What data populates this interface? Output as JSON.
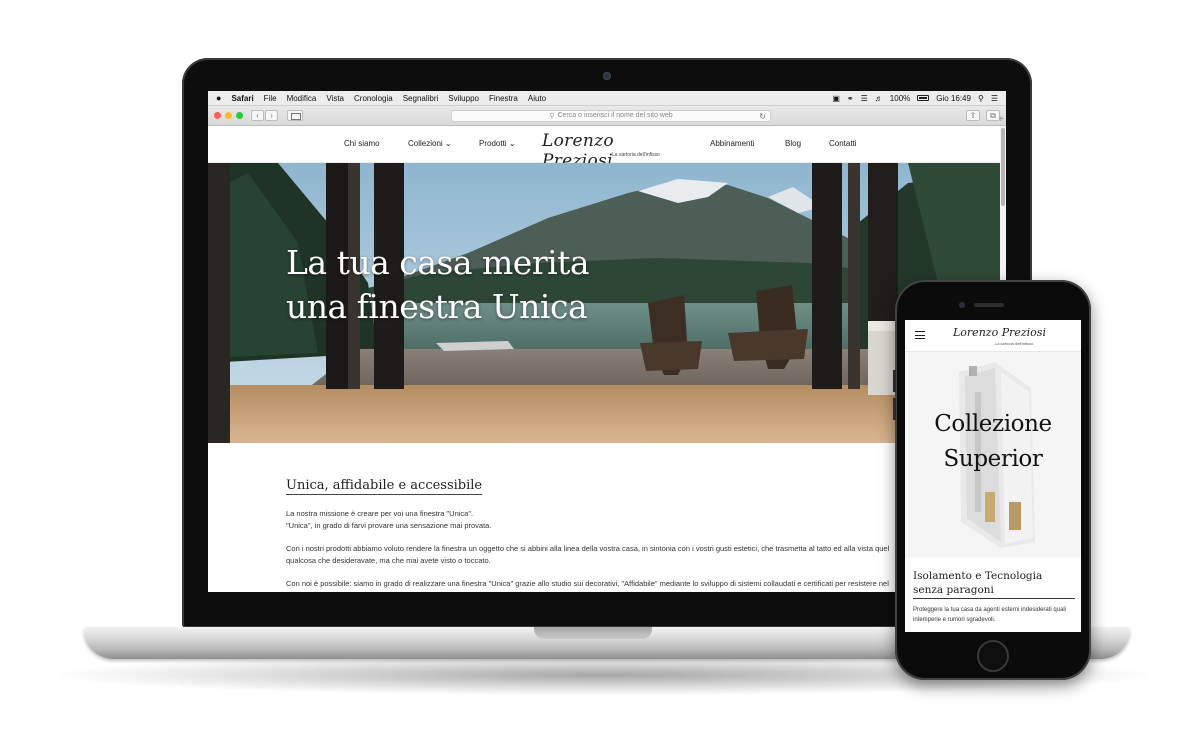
{
  "mac_menubar": {
    "apple": "",
    "items": [
      "Safari",
      "File",
      "Modifica",
      "Vista",
      "Cronologia",
      "Segnalibri",
      "Sviluppo",
      "Finestra",
      "Aiuto"
    ],
    "battery_text": "100%",
    "clock": "Gio 16:49"
  },
  "safari": {
    "address_placeholder": "Cerca o inserisci il nome del sito web"
  },
  "site": {
    "nav": {
      "chi_siamo": "Chi siamo",
      "collezioni": "Collezioni",
      "prodotti": "Prodotti",
      "abbinamenti": "Abbinamenti",
      "blog": "Blog",
      "contatti": "Contatti"
    },
    "logo": {
      "name": "Lorenzo Preziosi",
      "tagline": "La sartoria dell'infisso"
    },
    "hero": {
      "line1": "La tua casa merita",
      "line2": "una finestra Unica"
    },
    "section": {
      "title": "Unica, affidabile e accessibile",
      "para1_line1": "La nostra missione è creare per voi una finestra \"Unica\".",
      "para1_line2": "\"Unica\", in grado di farvi provare una sensazione mai provata.",
      "para2": "Con i nostri prodotti abbiamo voluto rendere la finestra un oggetto che si abbini alla linea della vostra casa, in sintonia con i vostri gusti estetici, che trasmetta al tatto ed alla vista quel qualcosa che desideravate, ma che mai avete visto o toccato.",
      "para3": "Con noi è possibile: siamo in grado di realizzare una finestra \"Unica\" grazie allo studio sui decorativi, \"Affidabile\" mediante lo sviluppo di sistemi collaudati e certificati per resistere nel tempo, \"Accessibile\" con una vasta gamma adatta ad ogni esigenza."
    }
  },
  "mobile": {
    "logo": {
      "name": "Lorenzo Preziosi",
      "tagline": "La sartoria dell'infisso"
    },
    "hero": {
      "line1": "Collezione",
      "line2": "Superior"
    },
    "section_title": "Isolamento e Tecnologia senza paragoni",
    "para": "Proteggere la tua casa da agenti esterni indesiderati quali intemperie e rumori sgradevoli."
  },
  "icons": {
    "apple": "apple-logo-icon",
    "wifi": "wifi-icon",
    "volume": "volume-icon",
    "battery": "battery-icon",
    "search": "spotlight-search-icon",
    "list": "notification-center-icon",
    "reload": "reload-icon",
    "share": "share-icon",
    "tabs": "tabs-icon"
  }
}
